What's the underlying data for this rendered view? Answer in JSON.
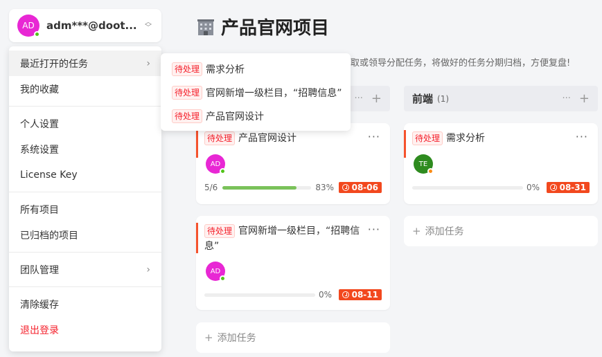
{
  "account": {
    "avatar": "AD",
    "name": "adm***@doot..."
  },
  "menu": {
    "recent": "最近打开的任务",
    "favorites": "我的收藏",
    "personal_settings": "个人设置",
    "system_settings": "系统设置",
    "license": "License Key",
    "all_projects": "所有项目",
    "archived": "已归档的项目",
    "team": "团队管理",
    "clear_cache": "清除缓存",
    "logout": "退出登录"
  },
  "recent_tasks": [
    {
      "tag": "待处理",
      "title": "需求分析"
    },
    {
      "tag": "待处理",
      "title": "官网新增一级栏目，“招聘信息”"
    },
    {
      "tag": "待处理",
      "title": "产品官网设计"
    }
  ],
  "project": {
    "title": "产品官网项目",
    "desc": "取或领导分配任务，将做好的任务分期归档，方便复盘!"
  },
  "columns": [
    {
      "name": "前端",
      "count": "(1)",
      "add_label": "添加任务"
    }
  ],
  "left_add_label": "添加任务",
  "cards": [
    {
      "tag": "待处理",
      "title": "产品官网设计",
      "avatar": "AD",
      "subtasks": "5/6",
      "progress": 83,
      "progress_label": "83%",
      "due": "08-06"
    },
    {
      "tag": "待处理",
      "title": "官网新增一级栏目，“招聘信息”",
      "avatar": "AD",
      "subtasks": "",
      "progress": 0,
      "progress_label": "0%",
      "due": "08-11"
    },
    {
      "tag": "待处理",
      "title": "需求分析",
      "avatar": "TE",
      "subtasks": "",
      "progress": 0,
      "progress_label": "0%",
      "due": "08-31"
    }
  ],
  "colors": {
    "accent": "#f2481e",
    "avatar_ad": "#e827d4",
    "avatar_te": "#2e8b1f",
    "progress": "#7ac25a"
  }
}
